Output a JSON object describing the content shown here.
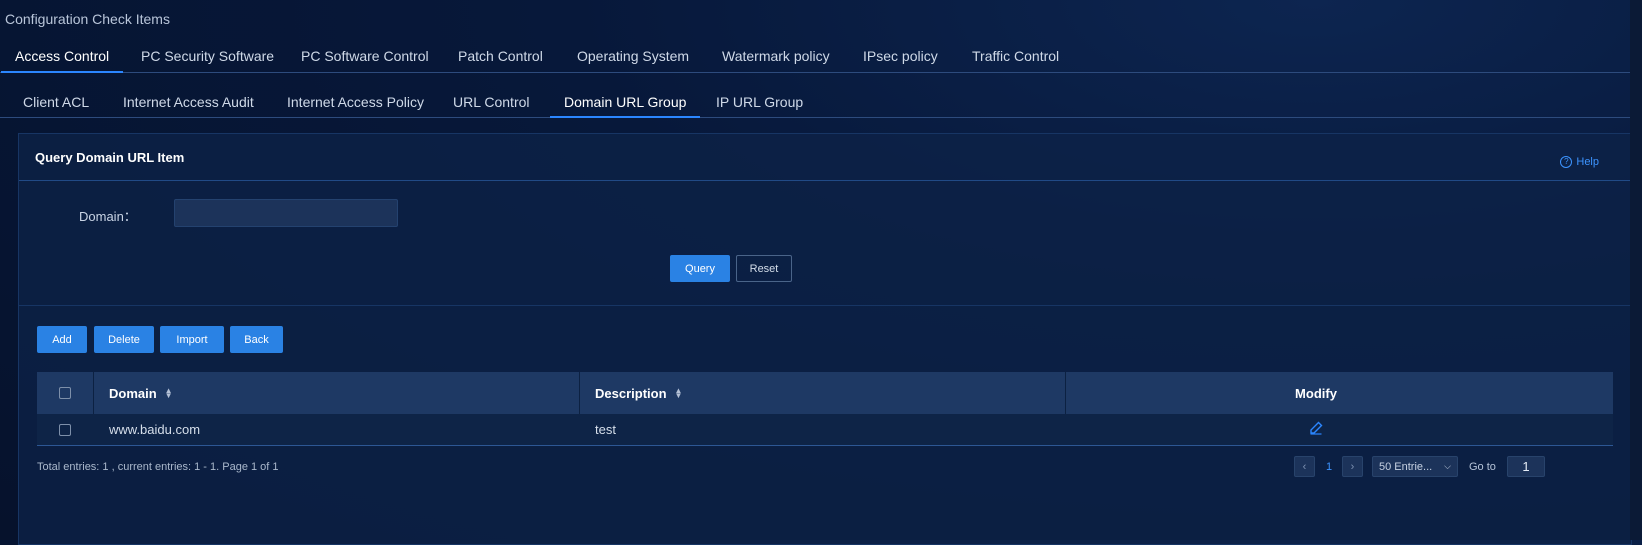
{
  "page": {
    "title": "Configuration Check Items"
  },
  "main_tabs": [
    {
      "label": "Access Control",
      "active": true
    },
    {
      "label": "PC Security Software",
      "active": false
    },
    {
      "label": "PC Software Control",
      "active": false
    },
    {
      "label": "Patch Control",
      "active": false
    },
    {
      "label": "Operating System",
      "active": false
    },
    {
      "label": "Watermark policy",
      "active": false
    },
    {
      "label": "IPsec policy",
      "active": false
    },
    {
      "label": "Traffic Control",
      "active": false
    }
  ],
  "sub_tabs": [
    {
      "label": "Client ACL",
      "active": false
    },
    {
      "label": "Internet Access Audit",
      "active": false
    },
    {
      "label": "Internet Access Policy",
      "active": false
    },
    {
      "label": "URL Control",
      "active": false
    },
    {
      "label": "Domain URL Group",
      "active": true
    },
    {
      "label": "IP URL Group",
      "active": false
    }
  ],
  "panel": {
    "title": "Query Domain URL Item",
    "help_label": "Help",
    "help_icon": "question-circle-icon"
  },
  "query_form": {
    "domain_label": "Domain：",
    "domain_value": "",
    "query_button": "Query",
    "reset_button": "Reset"
  },
  "toolbar": {
    "add": "Add",
    "delete": "Delete",
    "import": "Import",
    "back": "Back"
  },
  "table": {
    "columns": {
      "domain": "Domain",
      "description": "Description",
      "modify": "Modify"
    },
    "rows": [
      {
        "domain": "www.baidu.com",
        "description": "test",
        "modify_icon": "pencil-icon"
      }
    ]
  },
  "pagination": {
    "summary": "Total entries: 1 , current entries: 1 - 1. Page 1 of 1",
    "current_page": "1",
    "page_size": "50 Entrie...",
    "goto_label": "Go to",
    "goto_value": "1"
  },
  "colors": {
    "accent": "#2a82e4",
    "background": "#07183a",
    "header_row": "#1e3964"
  }
}
